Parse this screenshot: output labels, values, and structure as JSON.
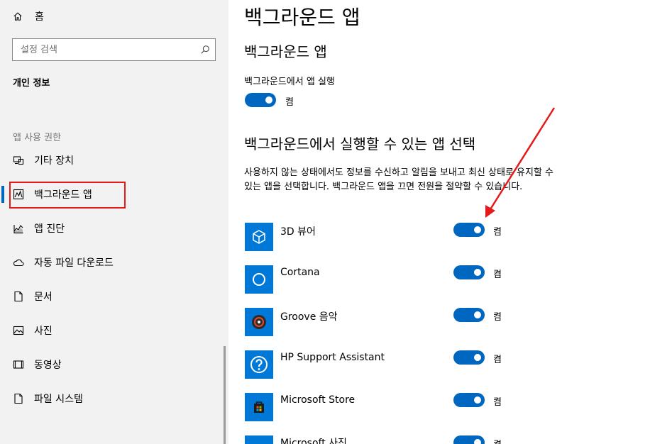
{
  "sidebar": {
    "home_label": "홈",
    "search_placeholder": "설정 검색",
    "section_title": "개인 정보",
    "group_label": "앱 사용 권한",
    "items": [
      {
        "label": "기타 장치",
        "icon": "devices-icon"
      },
      {
        "label": "백그라운드 앱",
        "icon": "background-apps-icon",
        "selected": true
      },
      {
        "label": "앱 진단",
        "icon": "diagnostics-icon"
      },
      {
        "label": "자동 파일 다운로드",
        "icon": "cloud-icon"
      },
      {
        "label": "문서",
        "icon": "document-icon"
      },
      {
        "label": "사진",
        "icon": "picture-icon"
      },
      {
        "label": "동영상",
        "icon": "video-icon"
      },
      {
        "label": "파일 시스템",
        "icon": "file-system-icon"
      }
    ]
  },
  "main": {
    "page_title": "백그라운드 앱",
    "section1_title": "백그라운드 앱",
    "run_label": "백그라운드에서 앱 실행",
    "run_state": "켬",
    "section2_title": "백그라운드에서 실행할 수 있는 앱 선택",
    "description": "사용하지 않는 상태에서도 정보를 수신하고 알림을 보내고 최신 상태로 유지할 수 있는 앱을 선택합니다. 백그라운드 앱을 끄면 전원을 절약할 수 있습니다.",
    "apps": [
      {
        "name": "3D 뷰어",
        "state": "켬",
        "icon": "cube-icon"
      },
      {
        "name": "Cortana",
        "state": "켬",
        "icon": "cortana-icon"
      },
      {
        "name": "Groove 음악",
        "state": "켬",
        "icon": "groove-music-icon"
      },
      {
        "name": "HP Support Assistant",
        "state": "켬",
        "icon": "help-icon"
      },
      {
        "name": "Microsoft Store",
        "state": "켬",
        "icon": "store-icon"
      },
      {
        "name": "Microsoft 사진",
        "state": "켬",
        "icon": "photos-icon"
      }
    ]
  },
  "colors": {
    "accent": "#0067c0",
    "tile": "#0078d7",
    "annotation": "#e51a1a"
  }
}
